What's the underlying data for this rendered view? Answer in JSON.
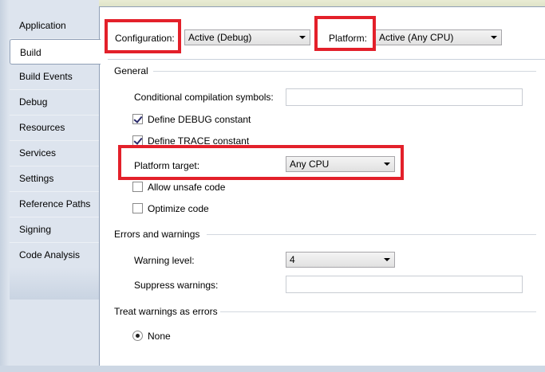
{
  "sidebar": {
    "tabs": [
      {
        "label": "Application"
      },
      {
        "label": "Build",
        "selected": true
      },
      {
        "label": "Build Events"
      },
      {
        "label": "Debug"
      },
      {
        "label": "Resources"
      },
      {
        "label": "Services"
      },
      {
        "label": "Settings"
      },
      {
        "label": "Reference Paths"
      },
      {
        "label": "Signing"
      },
      {
        "label": "Code Analysis"
      }
    ]
  },
  "header": {
    "configuration_label": "Configuration:",
    "configuration_value": "Active (Debug)",
    "platform_label": "Platform:",
    "platform_value": "Active (Any CPU)"
  },
  "general": {
    "title": "General",
    "conditional_symbols_label": "Conditional compilation symbols:",
    "conditional_symbols_value": "",
    "define_debug_label": "Define DEBUG constant",
    "define_debug_checked": true,
    "define_trace_label": "Define TRACE constant",
    "define_trace_checked": true,
    "platform_target_label": "Platform target:",
    "platform_target_value": "Any CPU",
    "allow_unsafe_label": "Allow unsafe code",
    "allow_unsafe_checked": false,
    "optimize_label": "Optimize code",
    "optimize_checked": false
  },
  "errors": {
    "title": "Errors and warnings",
    "warning_level_label": "Warning level:",
    "warning_level_value": "4",
    "suppress_label": "Suppress warnings:",
    "suppress_value": ""
  },
  "treat_warnings": {
    "title": "Treat warnings as errors",
    "none_label": "None",
    "none_selected": true
  },
  "colors": {
    "highlight": "#e3202a",
    "sidebar_bg": "#dde4ee",
    "content_bg": "#ffffff"
  }
}
